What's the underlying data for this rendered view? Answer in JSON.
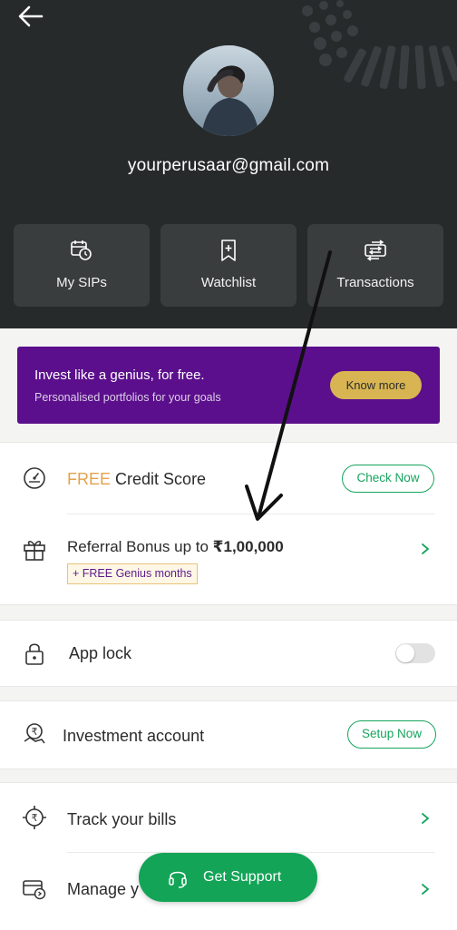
{
  "header": {
    "email": "yourperusaar@gmail.com",
    "tiles": [
      {
        "label": "My SIPs",
        "icon": "calendar-refresh-icon"
      },
      {
        "label": "Watchlist",
        "icon": "bookmark-plus-icon"
      },
      {
        "label": "Transactions",
        "icon": "transfer-arrows-icon"
      }
    ]
  },
  "banner": {
    "title": "Invest like a genius, for free.",
    "subtitle": "Personalised portfolios for your goals",
    "button": "Know more"
  },
  "credit": {
    "free": "FREE",
    "label": "Credit Score",
    "button": "Check Now"
  },
  "referral": {
    "label": "Referral Bonus up to ",
    "amount": "₹1,00,000",
    "badge": "+ FREE Genius months"
  },
  "app_lock": {
    "label": "App lock",
    "enabled": false
  },
  "investment": {
    "label": "Investment account",
    "button": "Setup Now"
  },
  "bills": {
    "label": "Track your bills"
  },
  "manage": {
    "label": "Manage y"
  },
  "support": {
    "label": "Get Support"
  },
  "colors": {
    "header_bg": "#272a2b",
    "tile_bg": "#3a3d3e",
    "banner_bg": "#5b0f8c",
    "banner_button": "#d8b552",
    "accent_green": "#13a457",
    "free_orange": "#e3a24b"
  }
}
